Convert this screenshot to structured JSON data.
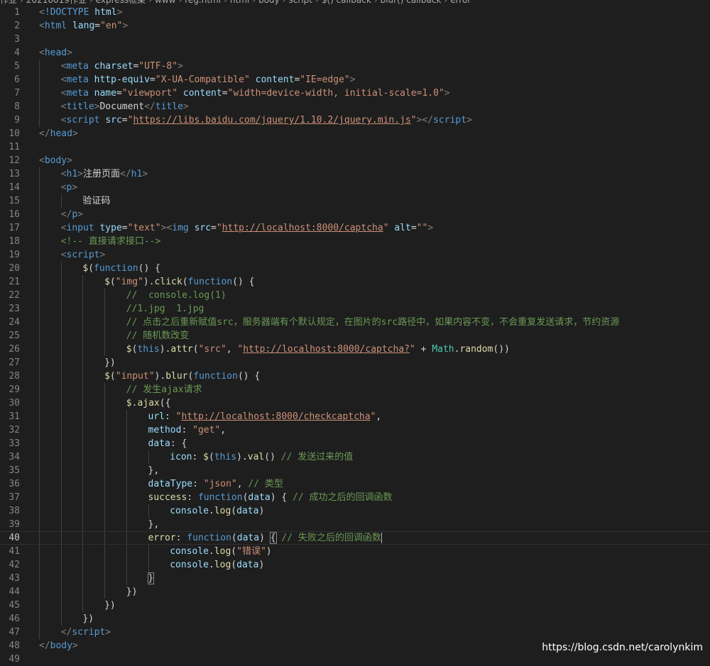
{
  "breadcrumb": [
    "作业",
    "20210019作业",
    "express框架",
    "www",
    "reg.html",
    "html",
    "body",
    "script",
    "$() callback",
    "blur() callback",
    "error"
  ],
  "current_line": 40,
  "lines": [
    {
      "n": 1,
      "indent": 0,
      "tokens": [
        [
          "t-bracket",
          "<"
        ],
        [
          "t-doc",
          "!DOCTYPE"
        ],
        [
          "t-txt",
          " "
        ],
        [
          "t-attr",
          "html"
        ],
        [
          "t-bracket",
          ">"
        ]
      ]
    },
    {
      "n": 2,
      "indent": 0,
      "tokens": [
        [
          "t-bracket",
          "<"
        ],
        [
          "t-tag",
          "html"
        ],
        [
          "t-txt",
          " "
        ],
        [
          "t-attr",
          "lang"
        ],
        [
          "t-txt",
          "="
        ],
        [
          "t-str",
          "\"en\""
        ],
        [
          "t-bracket",
          ">"
        ]
      ]
    },
    {
      "n": 3,
      "indent": 0,
      "tokens": []
    },
    {
      "n": 4,
      "indent": 0,
      "tokens": [
        [
          "t-bracket",
          "<"
        ],
        [
          "t-tag",
          "head"
        ],
        [
          "t-bracket",
          ">"
        ]
      ]
    },
    {
      "n": 5,
      "indent": 1,
      "tokens": [
        [
          "t-bracket",
          "<"
        ],
        [
          "t-tag",
          "meta"
        ],
        [
          "t-txt",
          " "
        ],
        [
          "t-attr",
          "charset"
        ],
        [
          "t-txt",
          "="
        ],
        [
          "t-str",
          "\"UTF-8\""
        ],
        [
          "t-bracket",
          ">"
        ]
      ]
    },
    {
      "n": 6,
      "indent": 1,
      "tokens": [
        [
          "t-bracket",
          "<"
        ],
        [
          "t-tag",
          "meta"
        ],
        [
          "t-txt",
          " "
        ],
        [
          "t-attr",
          "http-equiv"
        ],
        [
          "t-txt",
          "="
        ],
        [
          "t-str",
          "\"X-UA-Compatible\""
        ],
        [
          "t-txt",
          " "
        ],
        [
          "t-attr",
          "content"
        ],
        [
          "t-txt",
          "="
        ],
        [
          "t-str",
          "\"IE=edge\""
        ],
        [
          "t-bracket",
          ">"
        ]
      ]
    },
    {
      "n": 7,
      "indent": 1,
      "tokens": [
        [
          "t-bracket",
          "<"
        ],
        [
          "t-tag",
          "meta"
        ],
        [
          "t-txt",
          " "
        ],
        [
          "t-attr",
          "name"
        ],
        [
          "t-txt",
          "="
        ],
        [
          "t-str",
          "\"viewport\""
        ],
        [
          "t-txt",
          " "
        ],
        [
          "t-attr",
          "content"
        ],
        [
          "t-txt",
          "="
        ],
        [
          "t-str",
          "\"width=device-width, initial-scale=1.0\""
        ],
        [
          "t-bracket",
          ">"
        ]
      ]
    },
    {
      "n": 8,
      "indent": 1,
      "tokens": [
        [
          "t-bracket",
          "<"
        ],
        [
          "t-tag",
          "title"
        ],
        [
          "t-bracket",
          ">"
        ],
        [
          "t-txt",
          "Document"
        ],
        [
          "t-bracket",
          "</"
        ],
        [
          "t-tag",
          "title"
        ],
        [
          "t-bracket",
          ">"
        ]
      ]
    },
    {
      "n": 9,
      "indent": 1,
      "tokens": [
        [
          "t-bracket",
          "<"
        ],
        [
          "t-tag",
          "script"
        ],
        [
          "t-txt",
          " "
        ],
        [
          "t-attr",
          "src"
        ],
        [
          "t-txt",
          "="
        ],
        [
          "t-str",
          "\""
        ],
        [
          "t-url",
          "https://libs.baidu.com/jquery/1.10.2/jquery.min.js"
        ],
        [
          "t-str",
          "\""
        ],
        [
          "t-bracket",
          "></"
        ],
        [
          "t-tag",
          "script"
        ],
        [
          "t-bracket",
          ">"
        ]
      ]
    },
    {
      "n": 10,
      "indent": 0,
      "tokens": [
        [
          "t-bracket",
          "</"
        ],
        [
          "t-tag",
          "head"
        ],
        [
          "t-bracket",
          ">"
        ]
      ]
    },
    {
      "n": 11,
      "indent": 0,
      "tokens": []
    },
    {
      "n": 12,
      "indent": 0,
      "tokens": [
        [
          "t-bracket",
          "<"
        ],
        [
          "t-tag",
          "body"
        ],
        [
          "t-bracket",
          ">"
        ]
      ]
    },
    {
      "n": 13,
      "indent": 1,
      "tokens": [
        [
          "t-bracket",
          "<"
        ],
        [
          "t-tag",
          "h1"
        ],
        [
          "t-bracket",
          ">"
        ],
        [
          "t-txt",
          "注册页面"
        ],
        [
          "t-bracket",
          "</"
        ],
        [
          "t-tag",
          "h1"
        ],
        [
          "t-bracket",
          ">"
        ]
      ]
    },
    {
      "n": 14,
      "indent": 1,
      "tokens": [
        [
          "t-bracket",
          "<"
        ],
        [
          "t-tag",
          "p"
        ],
        [
          "t-bracket",
          ">"
        ]
      ]
    },
    {
      "n": 15,
      "indent": 2,
      "tokens": [
        [
          "t-txt",
          "验证码"
        ]
      ]
    },
    {
      "n": 16,
      "indent": 1,
      "tokens": [
        [
          "t-bracket",
          "</"
        ],
        [
          "t-tag",
          "p"
        ],
        [
          "t-bracket",
          ">"
        ]
      ]
    },
    {
      "n": 17,
      "indent": 1,
      "tokens": [
        [
          "t-bracket",
          "<"
        ],
        [
          "t-tag",
          "input"
        ],
        [
          "t-txt",
          " "
        ],
        [
          "t-attr",
          "type"
        ],
        [
          "t-txt",
          "="
        ],
        [
          "t-str",
          "\"text\""
        ],
        [
          "t-bracket",
          "><"
        ],
        [
          "t-tag",
          "img"
        ],
        [
          "t-txt",
          " "
        ],
        [
          "t-attr",
          "src"
        ],
        [
          "t-txt",
          "="
        ],
        [
          "t-str",
          "\""
        ],
        [
          "t-url",
          "http://localhost:8000/captcha"
        ],
        [
          "t-str",
          "\""
        ],
        [
          "t-txt",
          " "
        ],
        [
          "t-attr",
          "alt"
        ],
        [
          "t-txt",
          "="
        ],
        [
          "t-str",
          "\"\""
        ],
        [
          "t-bracket",
          ">"
        ]
      ]
    },
    {
      "n": 18,
      "indent": 1,
      "tokens": [
        [
          "t-com",
          "<!-- 直接请求接口-->"
        ]
      ]
    },
    {
      "n": 19,
      "indent": 1,
      "tokens": [
        [
          "t-bracket",
          "<"
        ],
        [
          "t-tag",
          "script"
        ],
        [
          "t-bracket",
          ">"
        ]
      ]
    },
    {
      "n": 20,
      "indent": 2,
      "tokens": [
        [
          "t-fn",
          "$"
        ],
        [
          "t-txt",
          "("
        ],
        [
          "t-kw",
          "function"
        ],
        [
          "t-txt",
          "() {"
        ]
      ]
    },
    {
      "n": 21,
      "indent": 3,
      "tokens": [
        [
          "t-fn",
          "$"
        ],
        [
          "t-txt",
          "("
        ],
        [
          "t-str",
          "\"img\""
        ],
        [
          "t-txt",
          ")."
        ],
        [
          "t-fn",
          "click"
        ],
        [
          "t-txt",
          "("
        ],
        [
          "t-kw",
          "function"
        ],
        [
          "t-txt",
          "() {"
        ]
      ]
    },
    {
      "n": 22,
      "indent": 4,
      "tokens": [
        [
          "t-com",
          "//  console.log(1)"
        ]
      ]
    },
    {
      "n": 23,
      "indent": 4,
      "tokens": [
        [
          "t-com",
          "//1.jpg  1.jpg"
        ]
      ]
    },
    {
      "n": 24,
      "indent": 4,
      "tokens": [
        [
          "t-com",
          "// 点击之后重新赋值src，服务器端有个默认规定，在图片的src路径中，如果内容不变，不会重复发送请求，节约资源"
        ]
      ]
    },
    {
      "n": 25,
      "indent": 4,
      "tokens": [
        [
          "t-com",
          "// 随机数改变"
        ]
      ]
    },
    {
      "n": 26,
      "indent": 4,
      "tokens": [
        [
          "t-fn",
          "$"
        ],
        [
          "t-txt",
          "("
        ],
        [
          "t-kw",
          "this"
        ],
        [
          "t-txt",
          ")."
        ],
        [
          "t-fn",
          "attr"
        ],
        [
          "t-txt",
          "("
        ],
        [
          "t-str",
          "\"src\""
        ],
        [
          "t-txt",
          ", "
        ],
        [
          "t-str",
          "\""
        ],
        [
          "t-url",
          "http://localhost:8000/captcha?"
        ],
        [
          "t-str",
          "\""
        ],
        [
          "t-txt",
          " + "
        ],
        [
          "t-cls",
          "Math"
        ],
        [
          "t-txt",
          "."
        ],
        [
          "t-fn",
          "random"
        ],
        [
          "t-txt",
          "())"
        ]
      ]
    },
    {
      "n": 27,
      "indent": 3,
      "tokens": [
        [
          "t-txt",
          "})"
        ]
      ]
    },
    {
      "n": 28,
      "indent": 3,
      "tokens": [
        [
          "t-fn",
          "$"
        ],
        [
          "t-txt",
          "("
        ],
        [
          "t-str",
          "\"input\""
        ],
        [
          "t-txt",
          ")."
        ],
        [
          "t-fn",
          "blur"
        ],
        [
          "t-txt",
          "("
        ],
        [
          "t-kw",
          "function"
        ],
        [
          "t-txt",
          "() {"
        ]
      ]
    },
    {
      "n": 29,
      "indent": 4,
      "tokens": [
        [
          "t-com",
          "// 发生ajax请求"
        ]
      ]
    },
    {
      "n": 30,
      "indent": 4,
      "tokens": [
        [
          "t-fn",
          "$"
        ],
        [
          "t-txt",
          "."
        ],
        [
          "t-fn",
          "ajax"
        ],
        [
          "t-txt",
          "({"
        ]
      ]
    },
    {
      "n": 31,
      "indent": 5,
      "tokens": [
        [
          "t-var",
          "url"
        ],
        [
          "t-txt",
          ": "
        ],
        [
          "t-str",
          "\""
        ],
        [
          "t-url",
          "http://localhost:8000/checkcaptcha"
        ],
        [
          "t-str",
          "\""
        ],
        [
          "t-txt",
          ","
        ]
      ]
    },
    {
      "n": 32,
      "indent": 5,
      "tokens": [
        [
          "t-var",
          "method"
        ],
        [
          "t-txt",
          ": "
        ],
        [
          "t-str",
          "\"get\""
        ],
        [
          "t-txt",
          ","
        ]
      ]
    },
    {
      "n": 33,
      "indent": 5,
      "tokens": [
        [
          "t-var",
          "data"
        ],
        [
          "t-txt",
          ": {"
        ]
      ]
    },
    {
      "n": 34,
      "indent": 6,
      "tokens": [
        [
          "t-var",
          "icon"
        ],
        [
          "t-txt",
          ": "
        ],
        [
          "t-fn",
          "$"
        ],
        [
          "t-txt",
          "("
        ],
        [
          "t-kw",
          "this"
        ],
        [
          "t-txt",
          ")."
        ],
        [
          "t-fn",
          "val"
        ],
        [
          "t-txt",
          "() "
        ],
        [
          "t-com",
          "// 发送过来的值"
        ]
      ]
    },
    {
      "n": 35,
      "indent": 5,
      "tokens": [
        [
          "t-txt",
          "},"
        ]
      ]
    },
    {
      "n": 36,
      "indent": 5,
      "tokens": [
        [
          "t-var",
          "dataType"
        ],
        [
          "t-txt",
          ": "
        ],
        [
          "t-str",
          "\"json\""
        ],
        [
          "t-txt",
          ", "
        ],
        [
          "t-com",
          "// 类型"
        ]
      ]
    },
    {
      "n": 37,
      "indent": 5,
      "tokens": [
        [
          "t-fn",
          "success"
        ],
        [
          "t-txt",
          ": "
        ],
        [
          "t-kw",
          "function"
        ],
        [
          "t-txt",
          "("
        ],
        [
          "t-var",
          "data"
        ],
        [
          "t-txt",
          ") { "
        ],
        [
          "t-com",
          "// 成功之后的回调函数"
        ]
      ]
    },
    {
      "n": 38,
      "indent": 6,
      "tokens": [
        [
          "t-var",
          "console"
        ],
        [
          "t-txt",
          "."
        ],
        [
          "t-fn",
          "log"
        ],
        [
          "t-txt",
          "("
        ],
        [
          "t-var",
          "data"
        ],
        [
          "t-txt",
          ")"
        ]
      ]
    },
    {
      "n": 39,
      "indent": 5,
      "tokens": [
        [
          "t-txt",
          "},"
        ]
      ]
    },
    {
      "n": 40,
      "indent": 5,
      "tokens": [
        [
          "t-fn",
          "error"
        ],
        [
          "t-txt",
          ": "
        ],
        [
          "t-kw",
          "function"
        ],
        [
          "t-txt",
          "("
        ],
        [
          "t-var",
          "data"
        ],
        [
          "t-txt",
          ") "
        ],
        [
          "t-match",
          "{"
        ],
        [
          "t-txt",
          " "
        ],
        [
          "t-com",
          "// 失败之后的回调函数"
        ],
        [
          "cursor",
          ""
        ]
      ]
    },
    {
      "n": 41,
      "indent": 6,
      "tokens": [
        [
          "t-var",
          "console"
        ],
        [
          "t-txt",
          "."
        ],
        [
          "t-fn",
          "log"
        ],
        [
          "t-txt",
          "("
        ],
        [
          "t-str",
          "\"错误\""
        ],
        [
          "t-txt",
          ")"
        ]
      ]
    },
    {
      "n": 42,
      "indent": 6,
      "tokens": [
        [
          "t-var",
          "console"
        ],
        [
          "t-txt",
          "."
        ],
        [
          "t-fn",
          "log"
        ],
        [
          "t-txt",
          "("
        ],
        [
          "t-var",
          "data"
        ],
        [
          "t-txt",
          ")"
        ]
      ]
    },
    {
      "n": 43,
      "indent": 5,
      "tokens": [
        [
          "t-match",
          "}"
        ]
      ]
    },
    {
      "n": 44,
      "indent": 4,
      "tokens": [
        [
          "t-txt",
          "})"
        ]
      ]
    },
    {
      "n": 45,
      "indent": 3,
      "tokens": [
        [
          "t-txt",
          "})"
        ]
      ]
    },
    {
      "n": 46,
      "indent": 2,
      "tokens": [
        [
          "t-txt",
          "})"
        ]
      ]
    },
    {
      "n": 47,
      "indent": 1,
      "tokens": [
        [
          "t-bracket",
          "</"
        ],
        [
          "t-tag",
          "script"
        ],
        [
          "t-bracket",
          ">"
        ]
      ]
    },
    {
      "n": 48,
      "indent": 0,
      "tokens": [
        [
          "t-bracket",
          "</"
        ],
        [
          "t-tag",
          "body"
        ],
        [
          "t-bracket",
          ">"
        ]
      ]
    },
    {
      "n": 49,
      "indent": 0,
      "tokens": []
    }
  ],
  "watermark": "https://blog.csdn.net/carolynkim"
}
